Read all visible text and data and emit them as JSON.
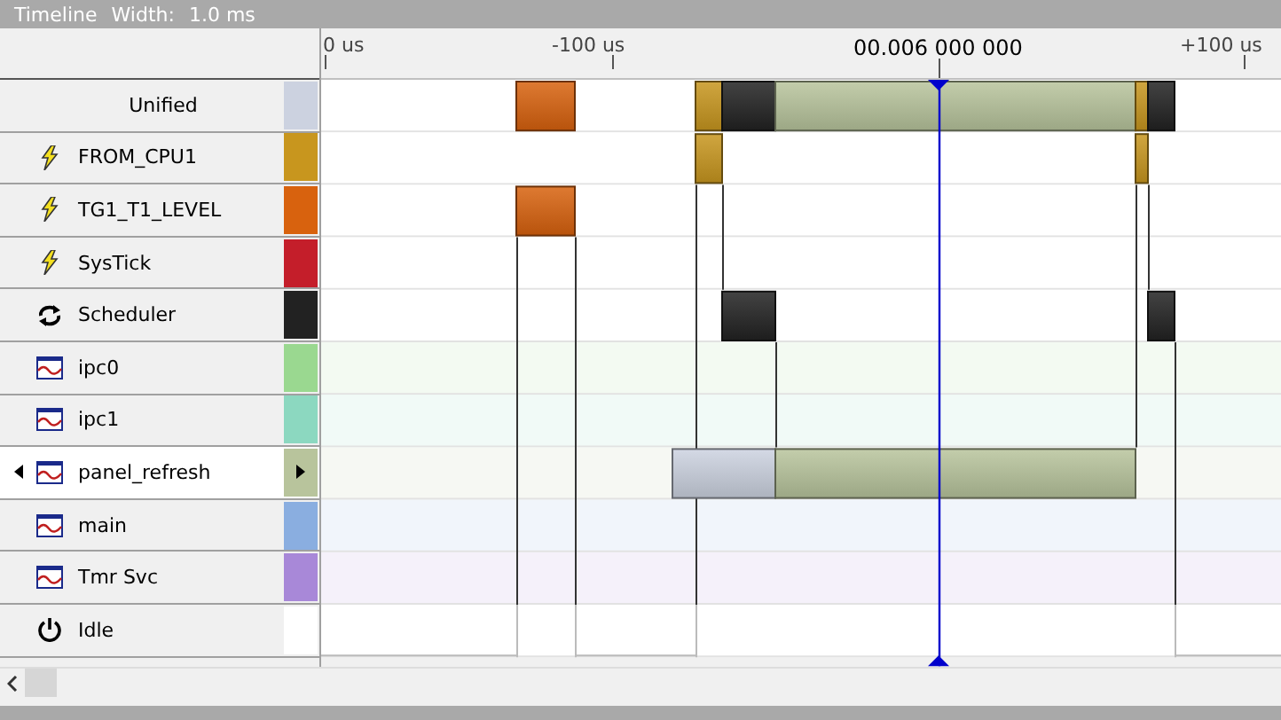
{
  "title_bar": {
    "title": "Timeline",
    "width_label": "Width:",
    "width_value": "1.0 ms"
  },
  "ruler": {
    "ticks": [
      "0 us",
      "-100 us",
      "+100 us"
    ],
    "cursor_time": "00.006 000 000"
  },
  "rows": [
    {
      "label": "Unified",
      "kind": "none",
      "color": "#ccd2e0",
      "selected": false
    },
    {
      "label": "FROM_CPU1",
      "kind": "interrupt",
      "color": "#c8961e",
      "selected": false
    },
    {
      "label": "TG1_T1_LEVEL",
      "kind": "interrupt",
      "color": "#d8620e",
      "selected": false
    },
    {
      "label": "SysTick",
      "kind": "interrupt",
      "color": "#c41e2a",
      "selected": false
    },
    {
      "label": "Scheduler",
      "kind": "scheduler",
      "color": "#222222",
      "selected": false
    },
    {
      "label": "ipc0",
      "kind": "task",
      "color": "#9ad890",
      "selected": false
    },
    {
      "label": "ipc1",
      "kind": "task",
      "color": "#8cd8c0",
      "selected": false
    },
    {
      "label": "panel_refresh",
      "kind": "task",
      "color": "#b8c49c",
      "selected": true
    },
    {
      "label": "main",
      "kind": "task",
      "color": "#8aaee0",
      "selected": false
    },
    {
      "label": "Tmr Svc",
      "kind": "task",
      "color": "#a888d8",
      "selected": false
    },
    {
      "label": "Idle",
      "kind": "idle",
      "color": "#ffffff",
      "selected": false
    }
  ]
}
